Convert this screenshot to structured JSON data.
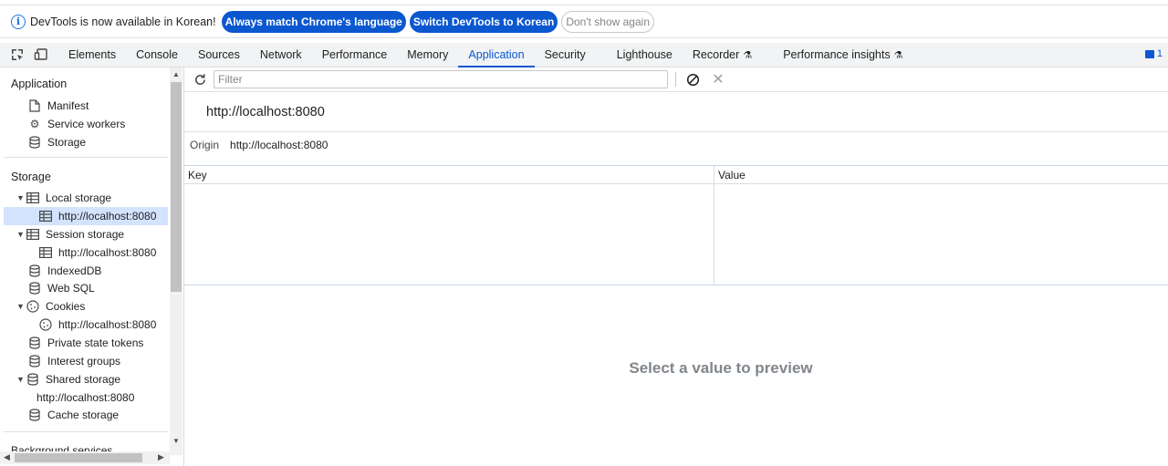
{
  "infobar": {
    "message": "DevTools is now available in Korean!",
    "btn_match": "Always match Chrome's language",
    "btn_switch": "Switch DevTools to Korean",
    "btn_dismiss": "Don't show again"
  },
  "tabs": [
    "Elements",
    "Console",
    "Sources",
    "Network",
    "Performance",
    "Memory",
    "Application",
    "Security",
    "Lighthouse",
    "Recorder",
    "Performance insights"
  ],
  "active_tab": "Application",
  "issues_count": "1",
  "sidebar": {
    "application_header": "Application",
    "manifest": "Manifest",
    "service_workers": "Service workers",
    "storage_item": "Storage",
    "storage_header": "Storage",
    "local_storage": "Local storage",
    "local_storage_origin": "http://localhost:8080",
    "session_storage": "Session storage",
    "session_storage_origin": "http://localhost:8080",
    "indexeddb": "IndexedDB",
    "websql": "Web SQL",
    "cookies": "Cookies",
    "cookies_origin": "http://localhost:8080",
    "private_state_tokens": "Private state tokens",
    "interest_groups": "Interest groups",
    "shared_storage": "Shared storage",
    "shared_storage_origin": "http://localhost:8080",
    "cache_storage": "Cache storage",
    "background_services": "Background services"
  },
  "main": {
    "filter_placeholder": "Filter",
    "title": "http://localhost:8080",
    "origin_label": "Origin",
    "origin_value": "http://localhost:8080",
    "col_key": "Key",
    "col_value": "Value",
    "preview_text": "Select a value to preview"
  },
  "colors": {
    "accent": "#0b57d0",
    "selected_bg": "#d3e3fd",
    "muted_text": "#80868b"
  }
}
